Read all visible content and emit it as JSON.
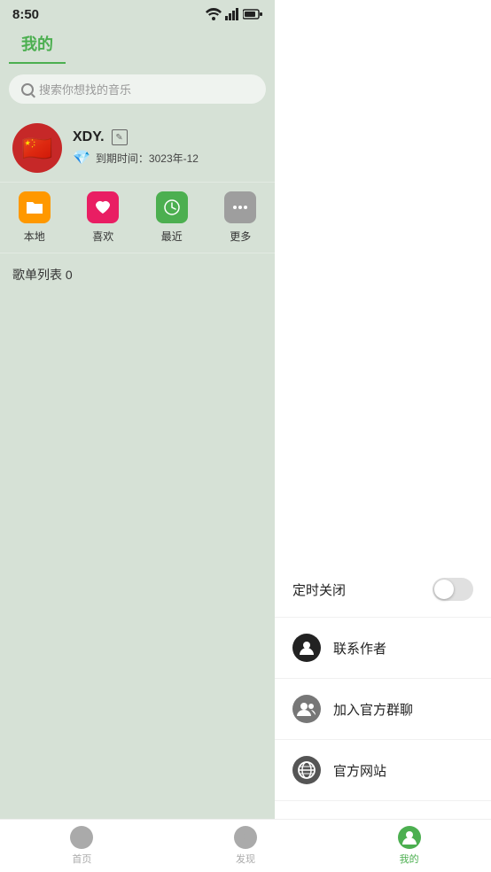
{
  "status": {
    "time": "8:50",
    "battery_icon": "▪"
  },
  "page": {
    "title": "我的"
  },
  "search": {
    "placeholder": "搜索你想找的音乐"
  },
  "user": {
    "name": "XDY.",
    "vip_label": "到期时间：3023年-12",
    "avatar_emoji": "🇨🇳"
  },
  "quick_access": [
    {
      "label": "本地",
      "type": "folder"
    },
    {
      "label": "喜欢",
      "type": "heart"
    },
    {
      "label": "最近",
      "type": "clock"
    },
    {
      "label": "更多",
      "type": "more"
    }
  ],
  "playlist": {
    "title": "歌单列表 0"
  },
  "right_menu": {
    "timer_label": "定时关闭",
    "timer_on": false,
    "items": [
      {
        "label": "联系作者",
        "icon_type": "person"
      },
      {
        "label": "加入官方群聊",
        "icon_type": "group"
      },
      {
        "label": "官方网站",
        "icon_type": "planet"
      }
    ]
  },
  "bottom_nav": [
    {
      "label": "首页",
      "active": false
    },
    {
      "label": "发现",
      "active": false
    },
    {
      "label": "我的",
      "active": true
    }
  ]
}
